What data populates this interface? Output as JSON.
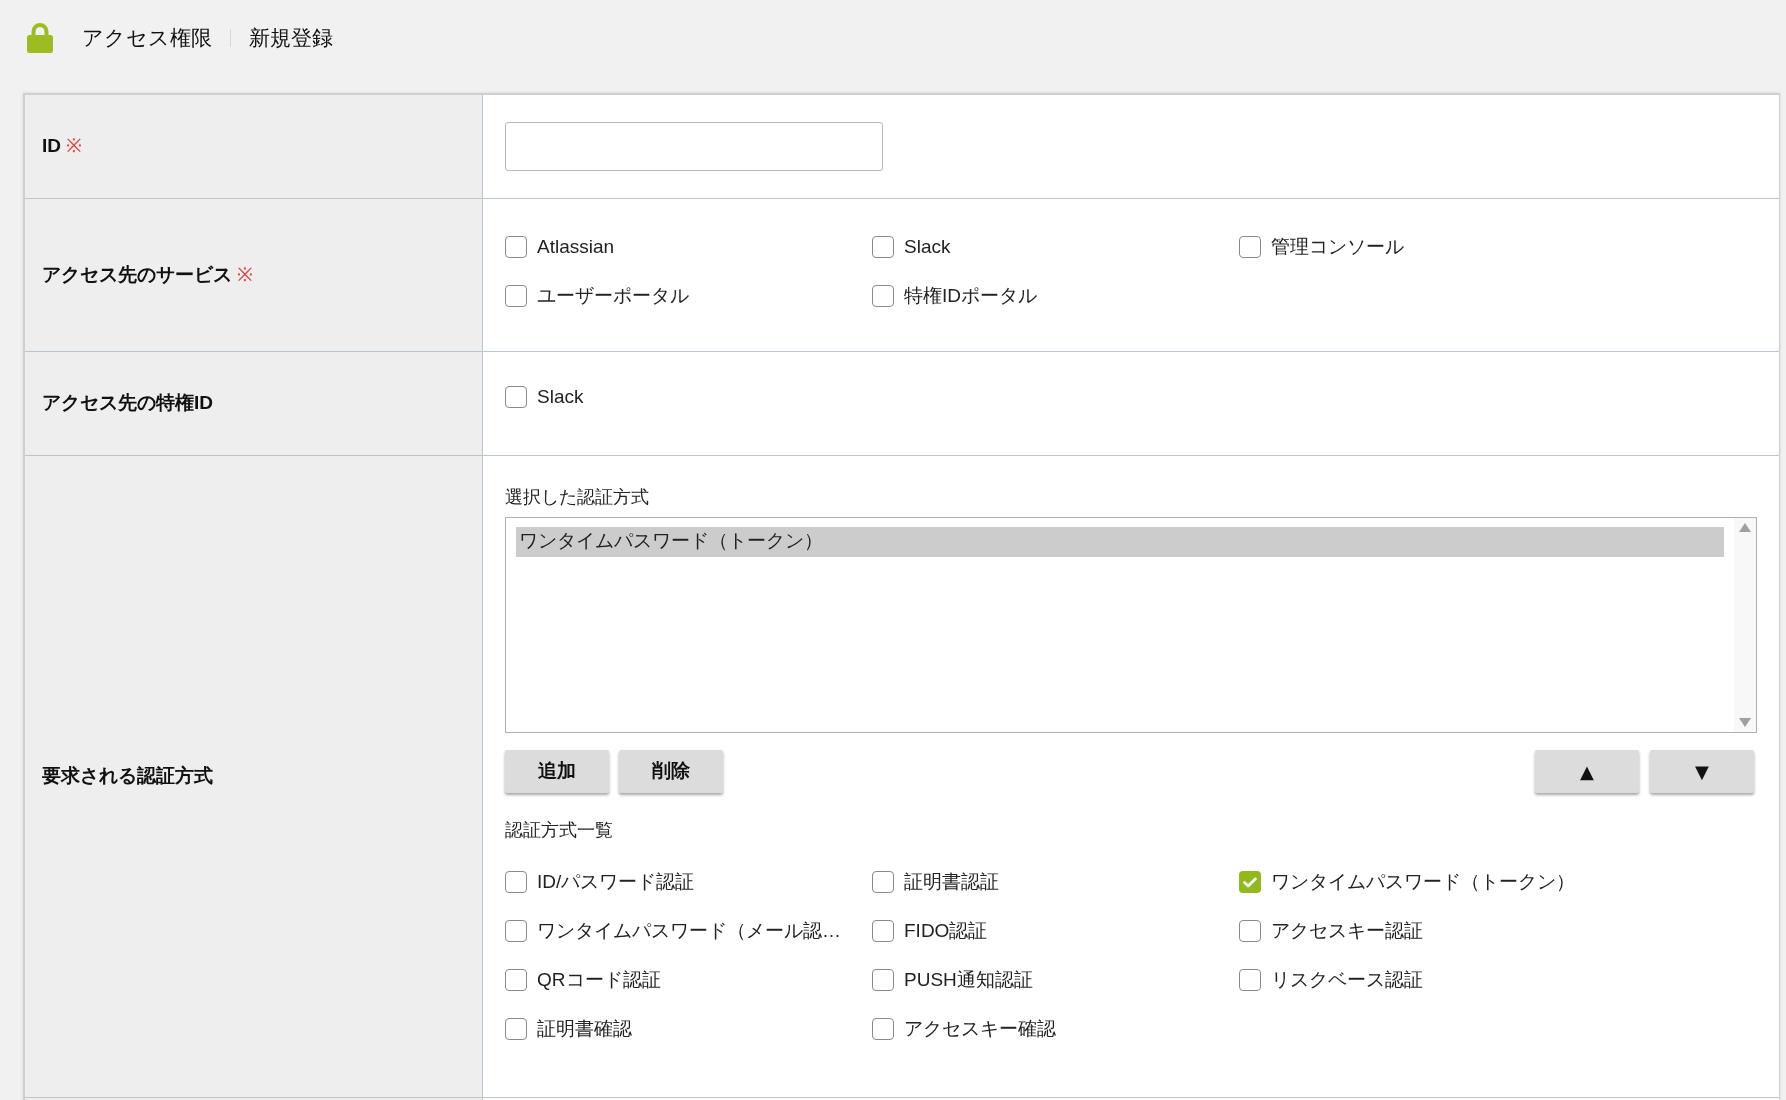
{
  "header": {
    "section_title": "アクセス権限",
    "page_title": "新規登録"
  },
  "form": {
    "rows": [
      {
        "kind": "input",
        "label": "ID",
        "required_mark": "※"
      },
      {
        "kind": "checkboxes",
        "label": "アクセス先のサービス",
        "required_mark": "※",
        "options": [
          {
            "label": "Atlassian",
            "checked": false
          },
          {
            "label": "Slack",
            "checked": false
          },
          {
            "label": "管理コンソール",
            "checked": false
          },
          {
            "label": "ユーザーポータル",
            "checked": false
          },
          {
            "label": "特権IDポータル",
            "checked": false
          }
        ]
      },
      {
        "kind": "checkboxes",
        "label": "アクセス先の特権ID",
        "options": [
          {
            "label": "Slack",
            "checked": false
          }
        ]
      },
      {
        "kind": "auth_methods",
        "label": "要求される認証方式",
        "selected_heading": "選択した認証方式",
        "selected_items": [
          {
            "label": "ワンタイムパスワード（トークン）",
            "selected": true
          }
        ],
        "buttons": [
          {
            "label": "追加"
          },
          {
            "label": "削除"
          }
        ],
        "order_buttons": [
          {
            "label": "▲"
          },
          {
            "label": "▼"
          }
        ],
        "list_heading": "認証方式一覧",
        "options": [
          {
            "label": "ID/パスワード認証",
            "checked": false
          },
          {
            "label": "証明書認証",
            "checked": false
          },
          {
            "label": "ワンタイムパスワード（トークン）",
            "checked": true
          },
          {
            "label": "ワンタイムパスワード（メール認…",
            "checked": false
          },
          {
            "label": "FIDO認証",
            "checked": false
          },
          {
            "label": "アクセスキー認証",
            "checked": false
          },
          {
            "label": "QRコード認証",
            "checked": false
          },
          {
            "label": "PUSH通知認証",
            "checked": false
          },
          {
            "label": "リスクベース認証",
            "checked": false
          },
          {
            "label": "証明書確認",
            "checked": false
          },
          {
            "label": "アクセスキー確認",
            "checked": false
          }
        ]
      }
    ]
  }
}
